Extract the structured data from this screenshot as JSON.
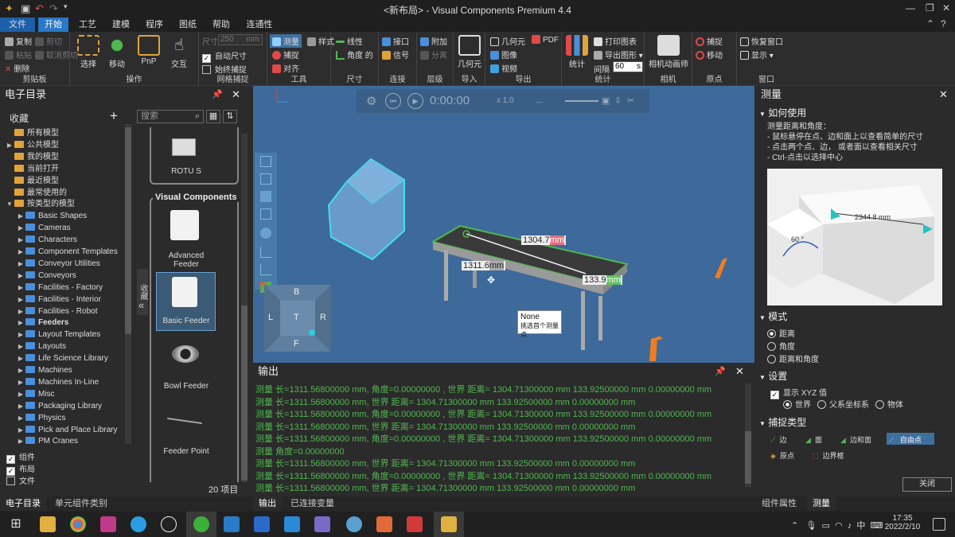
{
  "window": {
    "title": "<新布局> - Visual Components Premium 4.4"
  },
  "menu_tabs": [
    "文件",
    "开始",
    "工艺",
    "建模",
    "程序",
    "图纸",
    "帮助",
    "连通性"
  ],
  "ribbon": {
    "clipboard": {
      "label": "剪贴板",
      "copy": "复制",
      "cut": "剪切",
      "paste": "粘贴",
      "cancel_cut": "取消剪切",
      "delete": "删除"
    },
    "operation": {
      "label": "操作",
      "select": "选择",
      "move": "移动",
      "pnp": "PnP",
      "interact": "交互"
    },
    "grid": {
      "label": "网格捕捉",
      "size_label": "尺寸",
      "size_value": "250",
      "size_unit": "mm",
      "auto_size": "自动尺寸",
      "always_snap": "始终捕捉"
    },
    "tools": {
      "label": "工具",
      "measure": "测量",
      "style": "样式",
      "snap": "捕捉",
      "align": "对齐"
    },
    "dimension": {
      "label": "尺寸",
      "linear": "线性",
      "angle": "角度 的"
    },
    "connect": {
      "label": "连接",
      "interface": "接口",
      "signal": "信号"
    },
    "layer": {
      "label": "层级",
      "attach": "附加",
      "detach": "分离"
    },
    "import": {
      "label": "导入",
      "geometry": "几何元"
    },
    "export": {
      "label": "导出",
      "geometry": "几何元",
      "image": "图像",
      "video": "视频",
      "pdf": "PDF"
    },
    "stats": {
      "label": "统计",
      "stats": "统计",
      "print": "打印图表",
      "export_shape": "导出图形 ▾",
      "interval": "间隔",
      "interval_value": "60",
      "interval_unit": "s"
    },
    "camera": {
      "label": "相机",
      "animator": "相机动画师"
    },
    "origin": {
      "label": "原点",
      "snap": "捕捉",
      "move": "移动"
    },
    "window": {
      "label": "窗口",
      "restore": "恢复窗口",
      "display": "显示 ▾"
    }
  },
  "catalog": {
    "title": "电子目录",
    "favorites": "收藏",
    "search_placeholder": "搜索",
    "tree": [
      {
        "label": "所有模型",
        "icon": "y"
      },
      {
        "label": "公共模型",
        "icon": "y",
        "arrow": "▶"
      },
      {
        "label": "我的模型",
        "icon": "y"
      },
      {
        "label": "当前打开",
        "icon": "y"
      },
      {
        "label": "最近模型",
        "icon": "y"
      },
      {
        "label": "最常使用的",
        "icon": "y"
      },
      {
        "label": "按类型的模型",
        "icon": "y",
        "arrow": "▼"
      },
      {
        "label": "Basic Shapes",
        "arrow": "▶",
        "indent": 1
      },
      {
        "label": "Cameras",
        "arrow": "▶",
        "indent": 1
      },
      {
        "label": "Characters",
        "arrow": "▶",
        "indent": 1
      },
      {
        "label": "Component Templates",
        "arrow": "▶",
        "indent": 1
      },
      {
        "label": "Conveyor Utilities",
        "arrow": "▶",
        "indent": 1
      },
      {
        "label": "Conveyors",
        "arrow": "▶",
        "indent": 1
      },
      {
        "label": "Facilities - Factory",
        "arrow": "▶",
        "indent": 1
      },
      {
        "label": "Facilities - Interior",
        "arrow": "▶",
        "indent": 1
      },
      {
        "label": "Facilities - Robot",
        "arrow": "▶",
        "indent": 1
      },
      {
        "label": "Feeders",
        "arrow": "▶",
        "indent": 1,
        "bold": true
      },
      {
        "label": "Layout Templates",
        "arrow": "▶",
        "indent": 1
      },
      {
        "label": "Layouts",
        "arrow": "▶",
        "indent": 1
      },
      {
        "label": "Life Science Library",
        "arrow": "▶",
        "indent": 1
      },
      {
        "label": "Machines",
        "arrow": "▶",
        "indent": 1
      },
      {
        "label": "Machines In-Line",
        "arrow": "▶",
        "indent": 1
      },
      {
        "label": "Misc",
        "arrow": "▶",
        "indent": 1
      },
      {
        "label": "Packaging Library",
        "arrow": "▶",
        "indent": 1
      },
      {
        "label": "Physics",
        "arrow": "▶",
        "indent": 1
      },
      {
        "label": "Pick and Place Library",
        "arrow": "▶",
        "indent": 1
      },
      {
        "label": "PM Cranes",
        "arrow": "▶",
        "indent": 1
      }
    ],
    "filters": [
      {
        "label": "组件",
        "checked": true
      },
      {
        "label": "布局",
        "checked": true
      },
      {
        "label": "文件",
        "checked": false
      }
    ],
    "side_tab": "收藏",
    "group_title": "Visual Components",
    "items": [
      "ROTU S",
      "Advanced Feeder",
      "Basic Feeder",
      "Bowl Feeder",
      "Feeder Point"
    ],
    "count": "20 项目"
  },
  "viewport": {
    "time": "0:00:00",
    "speed": "x 1.0",
    "dim_1": "1304.7",
    "dim_1_unit": "mm",
    "dim_2": "1311.6",
    "dim_2_unit": "mm",
    "dim_3": "133.9",
    "dim_3_unit": "mm",
    "tooltip_title": "None",
    "tooltip_text": "挑选首个测量点",
    "cube": {
      "top": "B",
      "left": "L",
      "center": "T",
      "right": "R",
      "bottom": "F"
    }
  },
  "output": {
    "title": "输出",
    "lines": [
      "测量 长=1311.56800000 mm, 角度=0.00000000 , 世界 距离= 1304.71300000 mm  133.92500000 mm  0.00000000 mm",
      "测量 长=1311.56800000 mm, 世界 距离= 1304.71300000 mm  133.92500000 mm  0.00000000 mm",
      "测量 长=1311.56800000 mm, 角度=0.00000000 , 世界 距离= 1304.71300000 mm  133.92500000 mm  0.00000000 mm",
      "测量 长=1311.56800000 mm, 世界 距离= 1304.71300000 mm  133.92500000 mm  0.00000000 mm",
      "测量 长=1311.56800000 mm, 角度=0.00000000 , 世界 距离= 1304.71300000 mm  133.92500000 mm  0.00000000 mm",
      "测量 角度=0.00000000",
      "测量 长=1311.56800000 mm, 世界 距离= 1304.71300000 mm  133.92500000 mm  0.00000000 mm",
      "测量 长=1311.56800000 mm, 角度=0.00000000 , 世界 距离= 1304.71300000 mm  133.92500000 mm  0.00000000 mm",
      "测量 长=1311.56800000 mm, 世界 距离= 1304.71300000 mm  133.92500000 mm  0.00000000 mm"
    ],
    "tabs": [
      "输出",
      "已连接变量"
    ]
  },
  "measure_panel": {
    "title": "测量",
    "how_to": "如何使用",
    "desc": [
      "测量距离和角度：",
      "- 鼠标悬停在点、边和面上以查看简单的尺寸",
      "- 点击两个点、边， 或者面以查看相关尺寸",
      "- Ctrl-点击以选择中心"
    ],
    "preview_angle": "60 °",
    "preview_dist": "2344.8 mm",
    "mode_label": "模式",
    "modes": [
      {
        "label": "距离",
        "on": true
      },
      {
        "label": "角度",
        "on": false
      },
      {
        "label": "距离和角度",
        "on": false
      }
    ],
    "settings_label": "设置",
    "show_xyz": "显示 XYZ 值",
    "coord_options": [
      {
        "label": "世界",
        "on": true
      },
      {
        "label": "父系坐标系",
        "on": false
      },
      {
        "label": "物体",
        "on": false
      }
    ],
    "snap_label": "捕捉类型",
    "snap_types": [
      "边",
      "面",
      "边和面",
      "自由点",
      "原点",
      "边界框"
    ],
    "close": "关闭",
    "bottom_tabs": [
      "组件属性",
      "测量"
    ]
  },
  "left_bottom_tabs": [
    "电子目录",
    "单元组件类别"
  ],
  "taskbar": {
    "time": "17:35",
    "date": "2022/2/10",
    "ime": "中"
  }
}
